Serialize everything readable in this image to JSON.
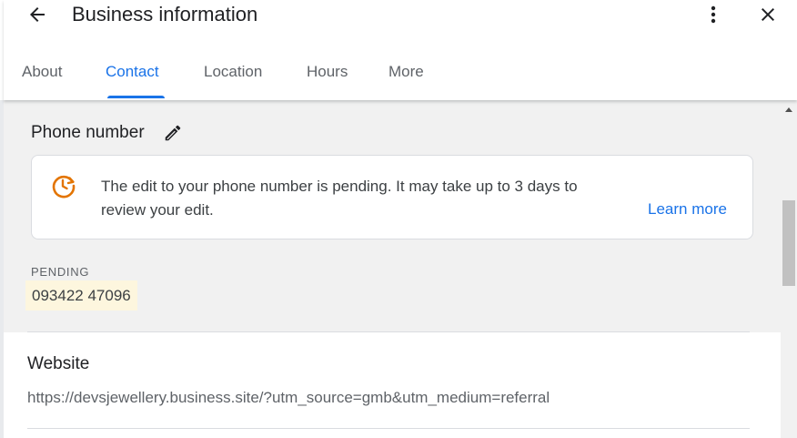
{
  "header": {
    "title": "Business information",
    "back_icon": "arrow-back-icon",
    "more_icon": "more-vertical-icon",
    "close_icon": "close-icon"
  },
  "tabs": [
    {
      "label": "About",
      "active": false
    },
    {
      "label": "Contact",
      "active": true
    },
    {
      "label": "Location",
      "active": false
    },
    {
      "label": "Hours",
      "active": false
    },
    {
      "label": "More",
      "active": false
    }
  ],
  "phone": {
    "heading": "Phone number",
    "edit_icon": "pencil-icon",
    "notice": {
      "icon": "pending-clock-icon",
      "text": "The edit to your phone number is pending. It may take up to 3 days to review your edit.",
      "link": "Learn more"
    },
    "pending_label": "PENDING",
    "pending_value": "093422 47096"
  },
  "website": {
    "heading": "Website",
    "value": "https://devsjewellery.business.site/?utm_source=gmb&utm_medium=referral"
  },
  "colors": {
    "accent": "#1a73e8",
    "pending_icon": "#e37400",
    "pending_highlight": "#fdf6de"
  }
}
